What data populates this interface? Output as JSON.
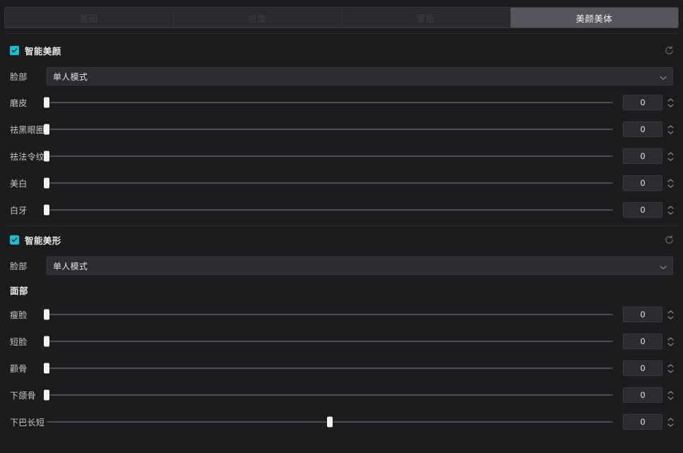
{
  "tabs": [
    {
      "label": "基础",
      "active": false
    },
    {
      "label": "抠像",
      "active": false
    },
    {
      "label": "蒙版",
      "active": false
    },
    {
      "label": "美颜美体",
      "active": true
    }
  ],
  "colors": {
    "accent": "#17c0cf",
    "panel_bg": "#1c1c1e",
    "tab_active_bg": "#55555d",
    "control_bg": "#2b2b30",
    "track": "#4a4a50",
    "thumb": "#f3f3f5"
  },
  "icons": {
    "reset": "reset-circular-arrow-icon",
    "chevron": "chevron-down-icon",
    "check": "check-icon",
    "spinner_up": "caret-up-icon",
    "spinner_down": "caret-down-icon"
  },
  "sections": [
    {
      "id": "smart-beauty",
      "title": "智能美颜",
      "checked": true,
      "reset_title": "重置",
      "select": {
        "label": "脸部",
        "value": "单人模式"
      },
      "sliders": [
        {
          "label": "磨皮",
          "value": "0",
          "percent": 0
        },
        {
          "label": "祛黑眼圈",
          "value": "0",
          "percent": 0
        },
        {
          "label": "祛法令纹",
          "value": "0",
          "percent": 0
        },
        {
          "label": "美白",
          "value": "0",
          "percent": 0
        },
        {
          "label": "白牙",
          "value": "0",
          "percent": 0
        }
      ]
    },
    {
      "id": "smart-reshape",
      "title": "智能美形",
      "checked": true,
      "reset_title": "重置",
      "select": {
        "label": "脸部",
        "value": "单人模式"
      },
      "subheading": "面部",
      "sliders": [
        {
          "label": "瘦脸",
          "value": "0",
          "percent": 0
        },
        {
          "label": "短脸",
          "value": "0",
          "percent": 0
        },
        {
          "label": "颧骨",
          "value": "0",
          "percent": 0
        },
        {
          "label": "下颌骨",
          "value": "0",
          "percent": 0
        },
        {
          "label": "下巴长短",
          "value": "0",
          "percent": 50
        }
      ]
    }
  ]
}
